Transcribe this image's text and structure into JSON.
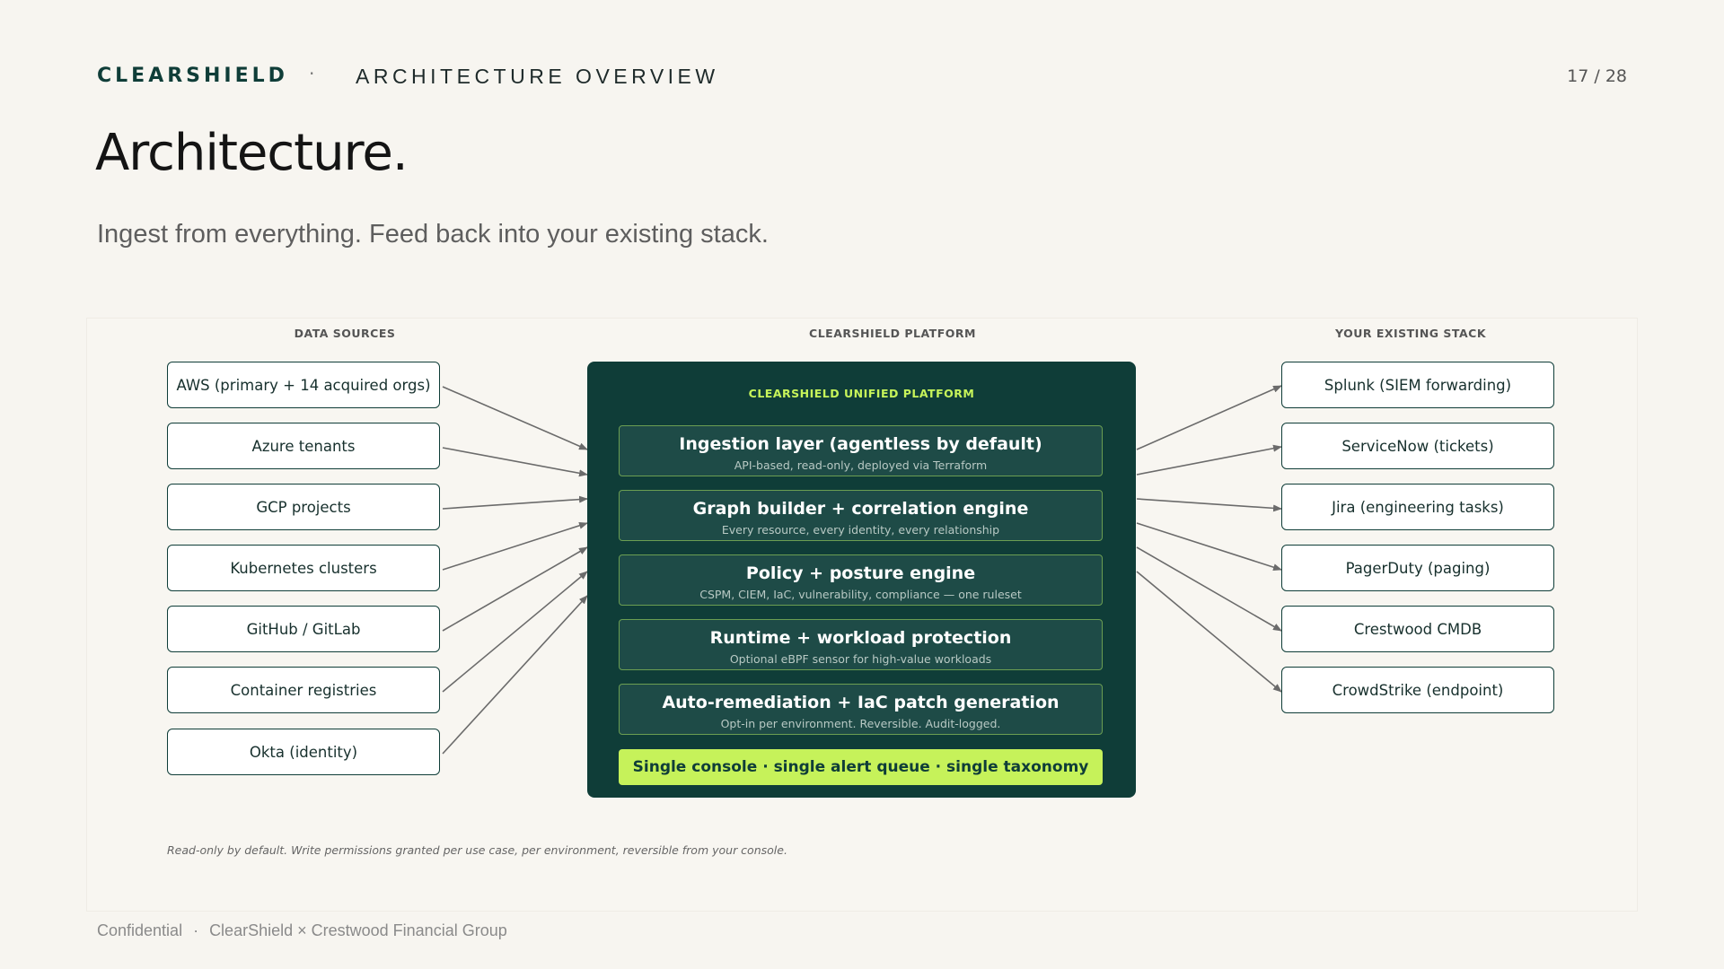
{
  "header": {
    "brand": "CLEARSHIELD",
    "separator": "·",
    "section": "ARCHITECTURE OVERVIEW",
    "page": "17 / 28"
  },
  "title": "Architecture.",
  "subtitle": "Ingest from everything. Feed back into your existing stack.",
  "diagram": {
    "sources_heading": "DATA SOURCES",
    "platform_heading": "CLEARSHIELD PLATFORM",
    "stack_heading": "YOUR EXISTING STACK",
    "sources": [
      "AWS (primary + 14 acquired orgs)",
      "Azure tenants",
      "GCP projects",
      "Kubernetes clusters",
      "GitHub / GitLab",
      "Container registries",
      "Okta (identity)"
    ],
    "platform": {
      "title": "CLEARSHIELD UNIFIED PLATFORM",
      "layers": [
        {
          "name": "Ingestion layer (agentless by default)",
          "desc": "API-based, read-only, deployed via Terraform"
        },
        {
          "name": "Graph builder + correlation engine",
          "desc": "Every resource, every identity, every relationship"
        },
        {
          "name": "Policy + posture engine",
          "desc": "CSPM, CIEM, IaC, vulnerability, compliance — one ruleset"
        },
        {
          "name": "Runtime + workload protection",
          "desc": "Optional eBPF sensor for high-value workloads"
        },
        {
          "name": "Auto-remediation + IaC patch generation",
          "desc": "Opt-in per environment. Reversible. Audit-logged."
        }
      ],
      "console": "Single console · single alert queue · single taxonomy"
    },
    "stack": [
      "Splunk (SIEM forwarding)",
      "ServiceNow (tickets)",
      "Jira (engineering tasks)",
      "PagerDuty (paging)",
      "Crestwood CMDB",
      "CrowdStrike (endpoint)"
    ],
    "footnote": "Read-only by default. Write permissions granted per use case, per environment, reversible from your console."
  },
  "footer": {
    "left": "Confidential",
    "separator": "·",
    "right": "ClearShield × Crestwood Financial Group"
  },
  "colors": {
    "background": "#f7f5f0",
    "platform": "#0f3d38",
    "layer": "#1e4b47",
    "accent": "#c6f25a",
    "arrow": "#6b6b6b"
  }
}
